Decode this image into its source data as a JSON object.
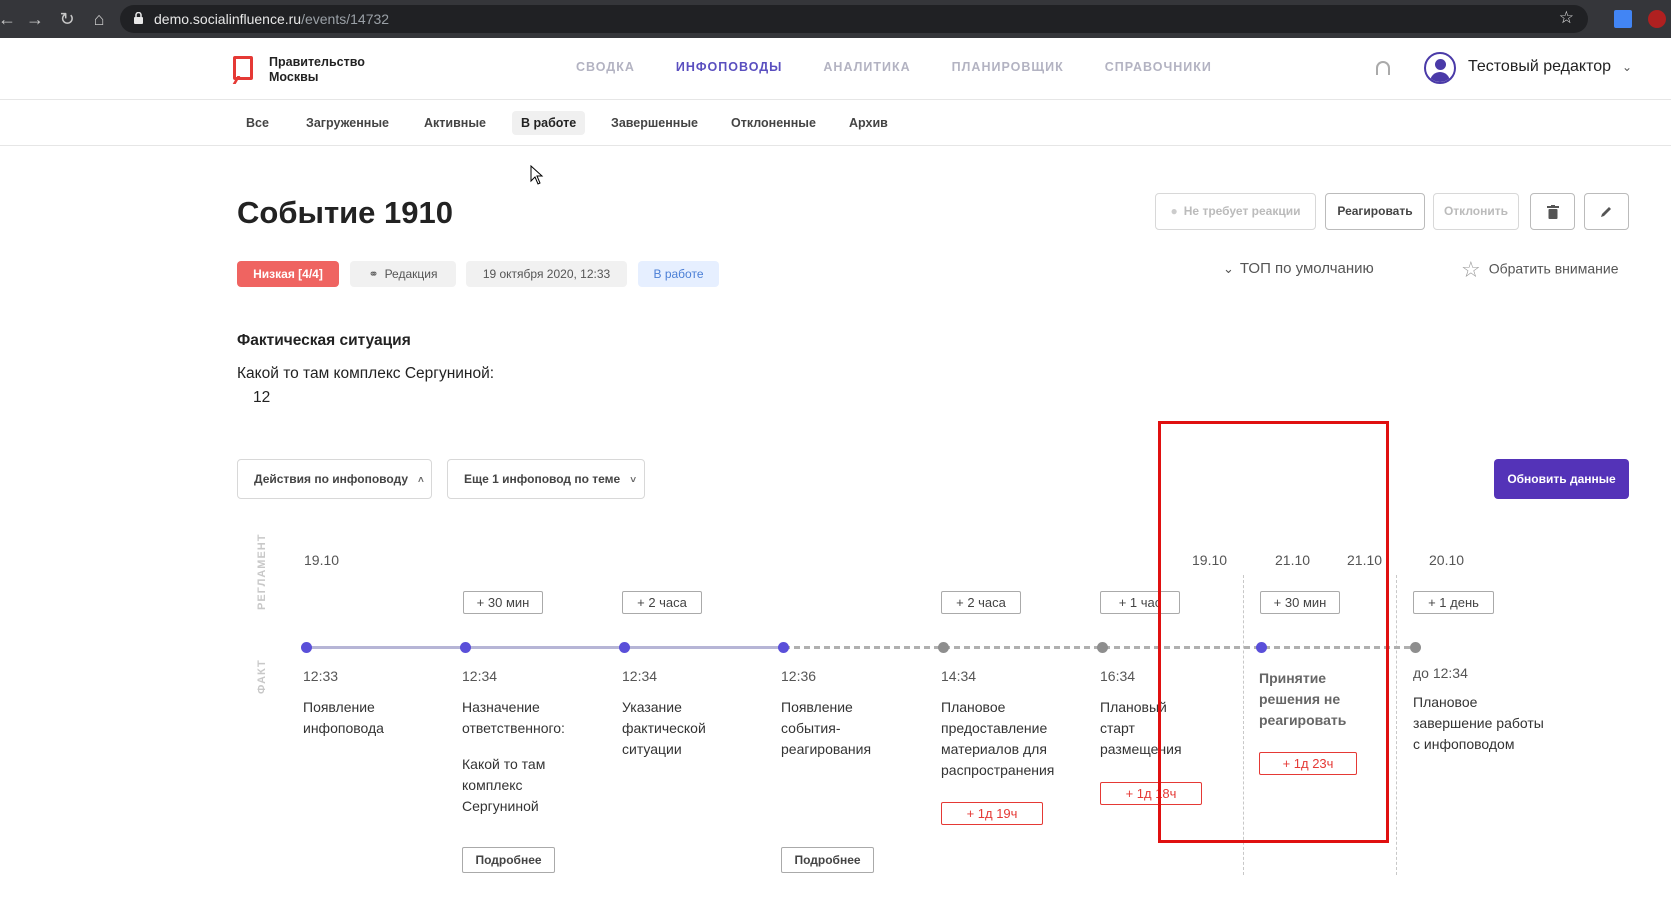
{
  "browser": {
    "url_domain": "demo.socialinfluence.ru",
    "url_path": "/events/14732"
  },
  "header": {
    "logo_text": "Правительство Москвы",
    "nav": [
      {
        "label": "Сводка",
        "active": false
      },
      {
        "label": "Инфоповоды",
        "active": true
      },
      {
        "label": "Аналитика",
        "active": false
      },
      {
        "label": "Планировщик",
        "active": false
      },
      {
        "label": "Справочники",
        "active": false
      }
    ],
    "user_name": "Тестовый редактор"
  },
  "subtabs": [
    {
      "label": "Все",
      "active": false
    },
    {
      "label": "Загруженные",
      "active": false
    },
    {
      "label": "Активные",
      "active": false
    },
    {
      "label": "В работе",
      "active": true
    },
    {
      "label": "Завершенные",
      "active": false
    },
    {
      "label": "Отклоненные",
      "active": false
    },
    {
      "label": "Архив",
      "active": false
    }
  ],
  "event": {
    "title": "Событие 1910",
    "actions": {
      "no_reaction": "Не требует реакции",
      "react": "Реагировать",
      "reject": "Отклонить"
    },
    "badges": {
      "priority": "Низкая [4/4]",
      "source": "Редакция",
      "date": "19 октября 2020, 12:33",
      "status": "В работе"
    },
    "top_default": "ТОП по умолчанию",
    "attention": "Обратить внимание",
    "fact_title": "Фактическая ситуация",
    "fact_text": "Какой то там комплекс Сергуниной:",
    "fact_number": "12"
  },
  "controls": {
    "actions_dropdown": "Действия по инфоповоду",
    "more_dropdown": "Еще 1 инфоповод по теме",
    "refresh": "Обновить данные"
  },
  "timeline": {
    "label_reglament": "РЕГЛАМЕНТ",
    "label_fact": "ФАКТ",
    "dates": [
      "19.10",
      "19.10",
      "21.10",
      "21.10",
      "20.10"
    ],
    "plus": [
      "+ 30 мин",
      "+ 2 часа",
      "+ 2 часа",
      "+ 1 час",
      "+ 30 мин",
      "+ 1 день"
    ],
    "steps": [
      {
        "time": "12:33",
        "label": "Появление инфоповода"
      },
      {
        "time": "12:34",
        "label": "Назначение ответственного:",
        "sub": "Какой то там комплекс Сергуниной",
        "more": "Подробнее"
      },
      {
        "time": "12:34",
        "label": "Указание фактической ситуации"
      },
      {
        "time": "12:36",
        "label": "Появление события-реагирования",
        "more": "Подробнее"
      },
      {
        "time": "14:34",
        "label": "Плановое предоставление материалов для распространения",
        "delay": "+ 1д 19ч"
      },
      {
        "time": "16:34",
        "label": "Плановый старт размещения",
        "delay": "+ 1д 18ч"
      },
      {
        "time": "",
        "label": "Принятие решения не реагировать",
        "delay": "+ 1д 23ч"
      },
      {
        "time": "до 12:34",
        "label": "Плановое завершение работы с инфоповодом"
      }
    ]
  },
  "colors": {
    "accent": "#5a4fd9",
    "primary_button": "#5433b8",
    "danger": "#e53935",
    "priority_low": "#ef6461"
  }
}
